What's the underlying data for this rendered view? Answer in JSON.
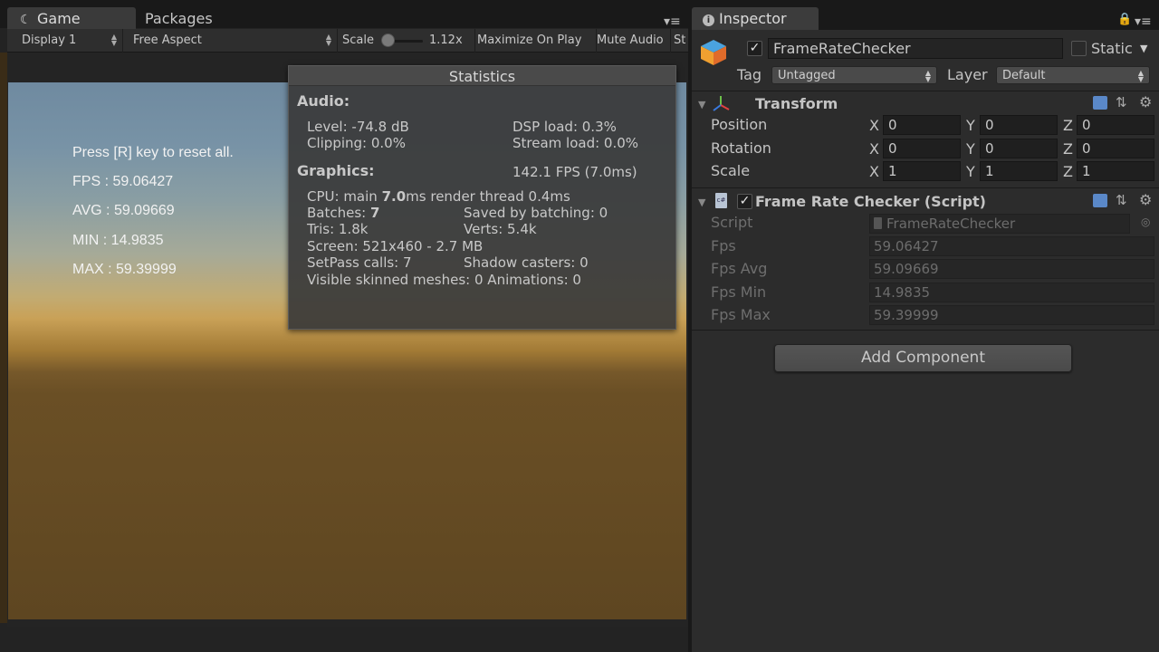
{
  "game_window": {
    "tabs": [
      {
        "label": "Game"
      },
      {
        "label": "Packages"
      }
    ],
    "toolbar": {
      "display": "Display 1",
      "aspect": "Free Aspect",
      "scale_label": "Scale",
      "scale_value": "1.12x",
      "maximize": "Maximize On Play",
      "mute": "Mute Audio",
      "stats": "St"
    },
    "overlay": {
      "reset_hint": "Press [R] key to reset all.",
      "fps": "FPS : 59.06427",
      "avg": "AVG : 59.09669",
      "min": "MIN : 14.9835",
      "max": "MAX : 59.39999"
    },
    "statistics": {
      "title": "Statistics",
      "audio_header": "Audio:",
      "level": "Level: -74.8 dB",
      "dsp_load": "DSP load: 0.3%",
      "clipping": "Clipping: 0.0%",
      "stream_load": "Stream load: 0.0%",
      "graphics_header": "Graphics:",
      "fps": "142.1 FPS (7.0ms)",
      "cpu_prefix": "CPU: main ",
      "cpu_main": "7.0",
      "cpu_suffix": "ms  render thread 0.4ms",
      "batches_label": "Batches: ",
      "batches_value": "7",
      "saved_batching": "Saved by batching: 0",
      "tris": "Tris: 1.8k",
      "verts": "Verts: 5.4k",
      "screen": "Screen: 521x460 - 2.7 MB",
      "setpass": "SetPass calls: 7",
      "shadow_casters": "Shadow casters: 0",
      "skinned": "Visible skinned meshes: 0  Animations: 0"
    }
  },
  "inspector": {
    "tab": "Inspector",
    "object_name": "FrameRateChecker",
    "static_label": "Static",
    "tag_label": "Tag",
    "tag_value": "Untagged",
    "layer_label": "Layer",
    "layer_value": "Default",
    "transform": {
      "title": "Transform",
      "rows": [
        {
          "label": "Position",
          "x": "0",
          "y": "0",
          "z": "0"
        },
        {
          "label": "Rotation",
          "x": "0",
          "y": "0",
          "z": "0"
        },
        {
          "label": "Scale",
          "x": "1",
          "y": "1",
          "z": "1"
        }
      ],
      "axis_x": "X",
      "axis_y": "Y",
      "axis_z": "Z"
    },
    "script_component": {
      "title": "Frame Rate Checker (Script)",
      "script_label": "Script",
      "script_value": "FrameRateChecker",
      "fields": [
        {
          "label": "Fps",
          "value": "59.06427"
        },
        {
          "label": "Fps Avg",
          "value": "59.09669"
        },
        {
          "label": "Fps Min",
          "value": "14.9835"
        },
        {
          "label": "Fps Max",
          "value": "59.39999"
        }
      ]
    },
    "add_component": "Add Component"
  }
}
